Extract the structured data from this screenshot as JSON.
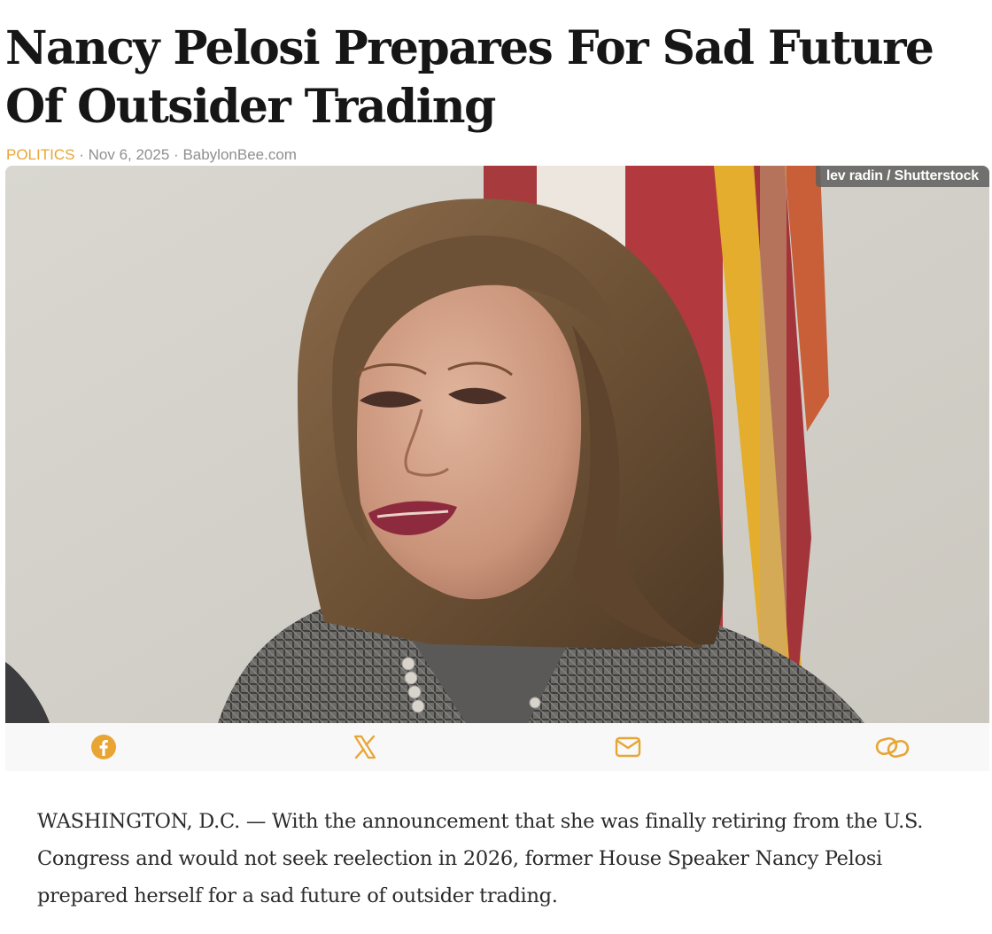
{
  "article": {
    "title": "Nancy Pelosi Prepares For Sad Future Of Outsider Trading",
    "category": "POLITICS",
    "separator": "·",
    "date": "Nov 6, 2025",
    "source": "BabylonBee.com",
    "image_credit": "lev radin / Shutterstock",
    "body": "WASHINGTON, D.C. — With the announcement that she was finally retiring from the U.S. Congress and would not seek reelection in 2026, former House Speaker Nancy Pelosi prepared herself for a sad future of outsider trading."
  },
  "share_buttons": [
    {
      "icon": "facebook-icon"
    },
    {
      "icon": "x-icon"
    },
    {
      "icon": "email-icon"
    },
    {
      "icon": "link-icon"
    }
  ],
  "colors": {
    "accent": "#e8a534",
    "headline": "#161616",
    "meta": "#8f8f8f",
    "body_text": "#2b2b2b",
    "share_bar_bg": "#f8f8f8"
  }
}
